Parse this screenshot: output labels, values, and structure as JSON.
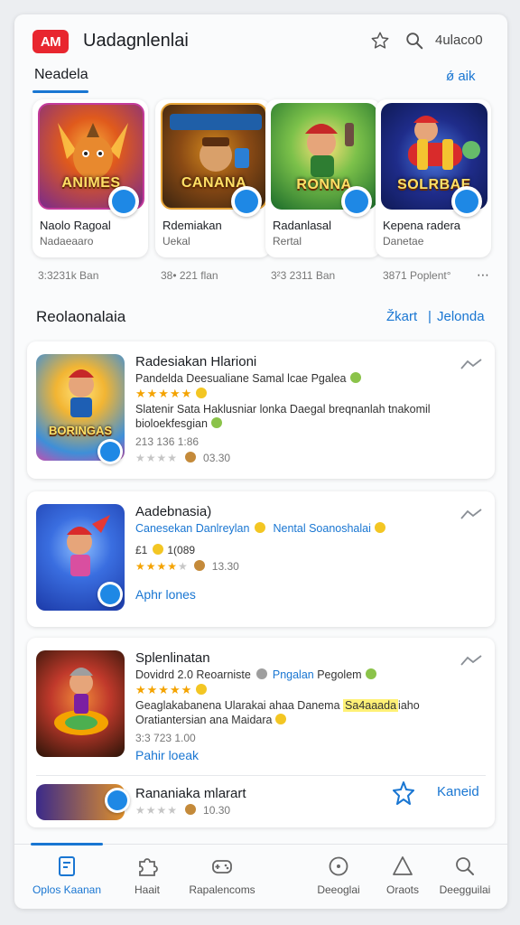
{
  "header": {
    "logo_text": "AM",
    "title": "Uadagnlenlai",
    "user_label": "4ulaco0",
    "icons": [
      "star-icon",
      "search-icon"
    ]
  },
  "tabs": {
    "active_label": "Neadela",
    "link_label": "ǿ aik"
  },
  "featured": [
    {
      "art_text": "ANIMES",
      "title": "Naolo Ragoal",
      "subtitle": "Nadaeaaro",
      "meta": "3:3231k Ban",
      "colors": [
        "#7a2a8c",
        "#e05a1c"
      ]
    },
    {
      "art_text": "CANANA",
      "title": "Rdemiakan",
      "subtitle": "Uekal",
      "meta": "38• 221 flan",
      "colors": [
        "#3a2410",
        "#d48a1e"
      ]
    },
    {
      "art_text": "RONNA",
      "title": "Radanlasal",
      "subtitle": "Rertal",
      "meta": "3²3 2311 Ban",
      "colors": [
        "#1a6b2a",
        "#e8b32a"
      ]
    },
    {
      "art_text": "SOLRBAE",
      "title": "Kepena radera",
      "subtitle": "Danetae",
      "meta": "3871 Poplent°",
      "colors": [
        "#0f1a55",
        "#d92b2b"
      ]
    }
  ],
  "more_label": "⋯",
  "section": {
    "title": "Reolaonalaia",
    "link_a": "Žkart",
    "separator": "|",
    "link_b": "Jelonda"
  },
  "list": [
    {
      "title": "Radesiakan Hlarioni",
      "line1": "Pandelda Deesualiane Samal lcae Pgalea",
      "rating_stars": 5,
      "description": "Slatenir Sata Haklusniar lonka Daegal breqnanlah tnakomil",
      "description2": "bioloekfesgian",
      "meta": "213 136 1:86",
      "meta2": "03.30",
      "art_text": "BORINGAS",
      "colors": [
        "#3e8fd8",
        "#f2b533"
      ]
    },
    {
      "title": "Aadebnasia)",
      "line1": "Canesekan Danlreylan",
      "line1b": "Nental Soanoshalai",
      "rating_line": "£1",
      "rating_extra": "1(089",
      "rating_stars": 4,
      "meta": "13.30",
      "link": "Aphr lones",
      "colors": [
        "#1c3aa8",
        "#5a9ae8"
      ]
    },
    {
      "title": "Splenlinatan",
      "line1": "Dovidrd 2.0 Reoarniste",
      "line1b": "Pngalan",
      "line1c": "Pegolem",
      "rating_stars": 5,
      "description": "Geaglakabanena Ularakai ahaa Danema",
      "highlight": "Sa4aaada",
      "description_end": "iaho",
      "description2": "Oratiantersian ana Maidara",
      "meta": "3:3 723 1.00",
      "link": "Pahir loeak",
      "colors": [
        "#2a1408",
        "#c0392b"
      ]
    },
    {
      "title": "Rananiaka mlarart",
      "meta": "10.30",
      "save_label": "Kaneid",
      "colors": [
        "#3b2a8a",
        "#e0902a"
      ]
    }
  ],
  "bottom_nav": [
    {
      "label": "Oplos Kaanan",
      "icon": "bookmark-icon",
      "active": true
    },
    {
      "label": "Haait",
      "icon": "puzzle-icon",
      "active": false
    },
    {
      "label": "Rapalencoms",
      "icon": "gamepad-icon",
      "active": false
    },
    {
      "label": "Deeoglai",
      "icon": "compass-icon",
      "active": false
    },
    {
      "label": "Oraots",
      "icon": "triangle-icon",
      "active": false
    },
    {
      "label": "Deegguilai",
      "icon": "search-icon",
      "active": false
    }
  ],
  "accent_color": "#1976d2"
}
